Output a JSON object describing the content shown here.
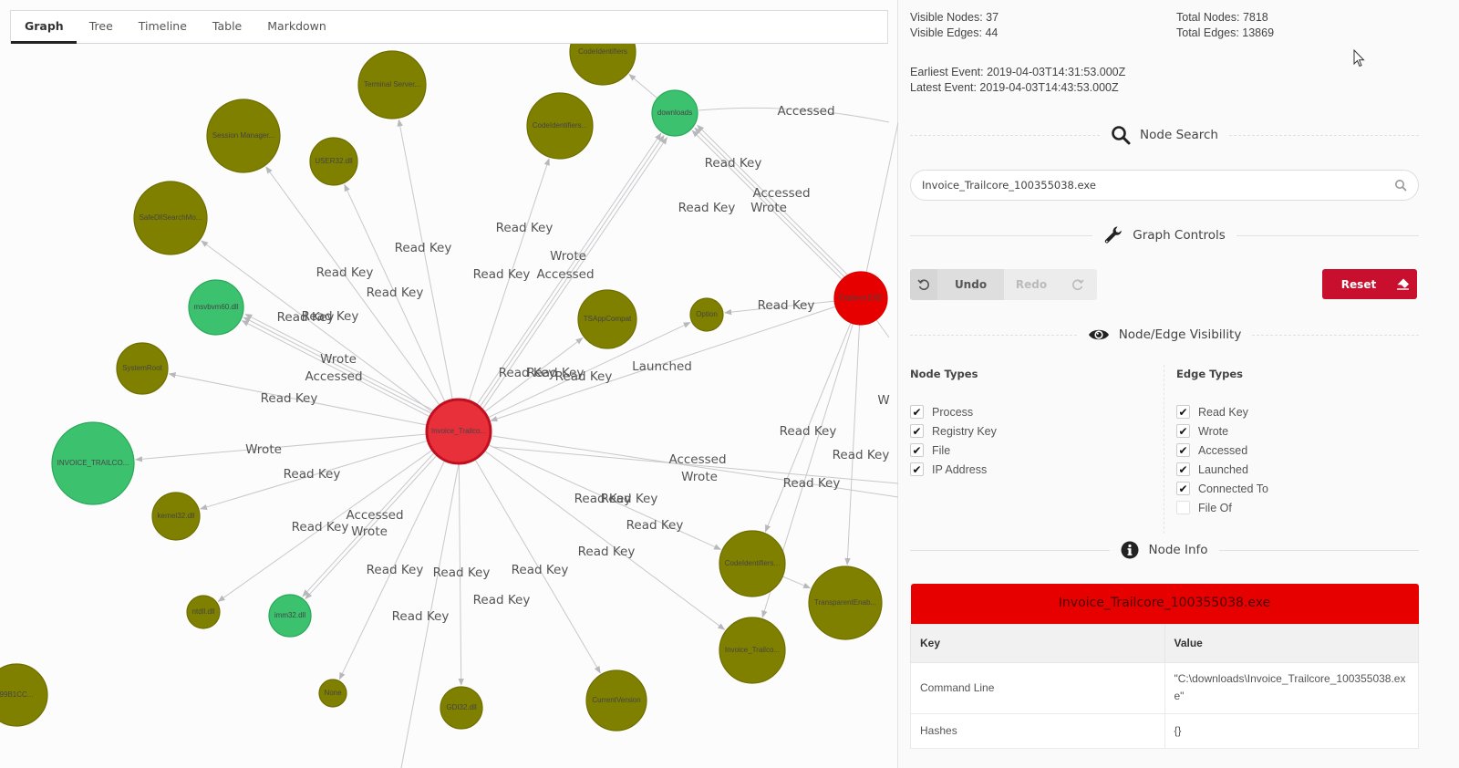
{
  "tabs": [
    {
      "label": "Graph",
      "active": true
    },
    {
      "label": "Tree",
      "active": false
    },
    {
      "label": "Timeline",
      "active": false
    },
    {
      "label": "Table",
      "active": false
    },
    {
      "label": "Markdown",
      "active": false
    }
  ],
  "colors": {
    "process_selected": "#e8303a",
    "process": "#e60000",
    "registry_key": "#808000",
    "file": "#3cc26f",
    "edge": "#c8c8cc",
    "reset": "#c8102e"
  },
  "graph": {
    "nodes": [
      {
        "id": "center",
        "label": "Invoice_Trailco...",
        "type": "process_selected"
      },
      {
        "id": "explorer",
        "label": "Explorer.EXE",
        "type": "process"
      },
      {
        "id": "codeid_top",
        "label": "CodeIdentifiers",
        "type": "registry_key"
      },
      {
        "id": "terminal",
        "label": "Terminal Server...",
        "type": "registry_key"
      },
      {
        "id": "session",
        "label": "Session Manager...",
        "type": "registry_key"
      },
      {
        "id": "user32",
        "label": "USER32.dll",
        "type": "registry_key"
      },
      {
        "id": "codeid2",
        "label": "CodeIdentifiers...",
        "type": "registry_key"
      },
      {
        "id": "downloads",
        "label": "downloads",
        "type": "file"
      },
      {
        "id": "safedll",
        "label": "SafeDllSearchMo...",
        "type": "registry_key"
      },
      {
        "id": "msvbvm",
        "label": "msvbvm60.dll",
        "type": "file"
      },
      {
        "id": "tsapp",
        "label": "TSAppCompat",
        "type": "registry_key"
      },
      {
        "id": "option",
        "label": "Option",
        "type": "registry_key"
      },
      {
        "id": "systemroot",
        "label": "SystemRoot",
        "type": "registry_key"
      },
      {
        "id": "invoice_file",
        "label": "INVOICE_TRAILCO...",
        "type": "file"
      },
      {
        "id": "kernel32",
        "label": "kernel32.dll",
        "type": "registry_key"
      },
      {
        "id": "ntdll",
        "label": "ntdll.dll",
        "type": "registry_key"
      },
      {
        "id": "imm32",
        "label": "imm32.dll",
        "type": "file"
      },
      {
        "id": "none",
        "label": "None",
        "type": "registry_key"
      },
      {
        "id": "gdi32",
        "label": "GDI32.dll",
        "type": "registry_key"
      },
      {
        "id": "currentversion",
        "label": "CurrentVersion",
        "type": "registry_key"
      },
      {
        "id": "codeid3",
        "label": "CodeIdentifiers...",
        "type": "registry_key"
      },
      {
        "id": "transparent",
        "label": "TransparentEnab...",
        "type": "registry_key"
      },
      {
        "id": "invoice_rk",
        "label": "Invoice_Trailco...",
        "type": "registry_key"
      },
      {
        "id": "b99",
        "label": "99B1CC...",
        "type": "registry_key"
      }
    ],
    "edges": [
      {
        "from": "center",
        "to": "session",
        "label": "Read Key"
      },
      {
        "from": "center",
        "to": "terminal",
        "label": "Read Key"
      },
      {
        "from": "center",
        "to": "user32",
        "label": "Read Key"
      },
      {
        "from": "center",
        "to": "codeid2",
        "label": "Read Key"
      },
      {
        "from": "center",
        "to": "downloads",
        "label": "Read Key"
      },
      {
        "from": "center",
        "to": "downloads",
        "label": "Wrote"
      },
      {
        "from": "center",
        "to": "downloads",
        "label": "Accessed"
      },
      {
        "from": "center",
        "to": "safedll",
        "label": "Read Key"
      },
      {
        "from": "center",
        "to": "msvbvm",
        "label": "Read Key"
      },
      {
        "from": "center",
        "to": "msvbvm",
        "label": "Wrote"
      },
      {
        "from": "center",
        "to": "msvbvm",
        "label": "Accessed"
      },
      {
        "from": "center",
        "to": "systemroot",
        "label": "Read Key"
      },
      {
        "from": "center",
        "to": "tsapp",
        "label": "Read Key"
      },
      {
        "from": "center",
        "to": "option",
        "label": "Read Key"
      },
      {
        "from": "center",
        "to": "invoice_file",
        "label": "Wrote"
      },
      {
        "from": "center",
        "to": "kernel32",
        "label": "Read Key"
      },
      {
        "from": "center",
        "to": "ntdll",
        "label": "Read Key"
      },
      {
        "from": "center",
        "to": "imm32",
        "label": "Accessed"
      },
      {
        "from": "center",
        "to": "imm32",
        "label": "Wrote"
      },
      {
        "from": "center",
        "to": "none",
        "label": "Read Key"
      },
      {
        "from": "center",
        "to": "gdi32",
        "label": "Read Key"
      },
      {
        "from": "center",
        "to": "currentversion",
        "label": "Read Key"
      },
      {
        "from": "center",
        "to": "codeid3",
        "label": "Read Key"
      },
      {
        "from": "center",
        "to": "invoice_rk",
        "label": "Read Key"
      },
      {
        "from": "explorer",
        "to": "center",
        "label": "Launched"
      },
      {
        "from": "explorer",
        "to": "option",
        "label": "Read Key"
      },
      {
        "from": "explorer",
        "to": "downloads",
        "label": "Read Key"
      },
      {
        "from": "explorer",
        "to": "downloads",
        "label": "Accessed"
      },
      {
        "from": "explorer",
        "to": "downloads",
        "label": "Wrote"
      },
      {
        "from": "explorer",
        "to": "codeid3",
        "label": "Read Key"
      },
      {
        "from": "explorer",
        "to": "invoice_rk",
        "label": "Read Key"
      },
      {
        "from": "explorer",
        "to": "transparent",
        "label": "Read Key"
      },
      {
        "from": "downloads",
        "to": "codeid_top",
        "label": ""
      },
      {
        "from": "codeid3",
        "to": "transparent",
        "label": ""
      }
    ],
    "edge_labels_floating": [
      "Accessed",
      "Read Key",
      "Accessed",
      "Wrote",
      "Read Key",
      "Read Key",
      "Read Key",
      "Read Key",
      "Wrote",
      "Accessed",
      "Read Key",
      "Read Key",
      "Read Key",
      "Read Key",
      "Wrote",
      "Accessed",
      "Read Key",
      "Read Key",
      "Read Key",
      "Launched",
      "Read Key",
      "Wrote",
      "Read Key",
      "Accessed",
      "Wrote",
      "Read Key",
      "Read Key",
      "Read Key",
      "Read Key",
      "Accessed",
      "Wrote",
      "Read Key",
      "Read Key",
      "Read Key",
      "Read Key",
      "Read Key",
      "Read Key",
      "Read Key",
      "Read Key",
      "Read Key",
      "W",
      "Read Key"
    ]
  },
  "stats": {
    "visible_nodes": "Visible Nodes: 37",
    "visible_edges": "Visible Edges: 44",
    "total_nodes": "Total Nodes: 7818",
    "total_edges": "Total Edges: 13869",
    "earliest_event": "Earliest Event: 2019-04-03T14:31:53.000Z",
    "latest_event": "Latest Event: 2019-04-03T14:43:53.000Z"
  },
  "node_search": {
    "title": "Node Search",
    "value": "Invoice_Trailcore_100355038.exe",
    "placeholder": ""
  },
  "graph_controls": {
    "title": "Graph Controls",
    "undo_label": "Undo",
    "redo_label": "Redo",
    "reset_label": "Reset"
  },
  "visibility": {
    "title": "Node/Edge Visibility",
    "node_types_title": "Node Types",
    "edge_types_title": "Edge Types",
    "node_types": [
      {
        "label": "Process",
        "checked": true
      },
      {
        "label": "Registry Key",
        "checked": true
      },
      {
        "label": "File",
        "checked": true
      },
      {
        "label": "IP Address",
        "checked": true
      }
    ],
    "edge_types": [
      {
        "label": "Read Key",
        "checked": true
      },
      {
        "label": "Wrote",
        "checked": true
      },
      {
        "label": "Accessed",
        "checked": true
      },
      {
        "label": "Launched",
        "checked": true
      },
      {
        "label": "Connected To",
        "checked": true
      },
      {
        "label": "File Of",
        "checked": false
      }
    ]
  },
  "node_info": {
    "title": "Node Info",
    "node_name": "Invoice_Trailcore_100355038.exe",
    "key_header": "Key",
    "value_header": "Value",
    "rows": [
      {
        "key": "Command Line",
        "value": "\"C:\\downloads\\Invoice_Trailcore_100355038.exe\""
      },
      {
        "key": "Hashes",
        "value": "{}"
      }
    ]
  }
}
